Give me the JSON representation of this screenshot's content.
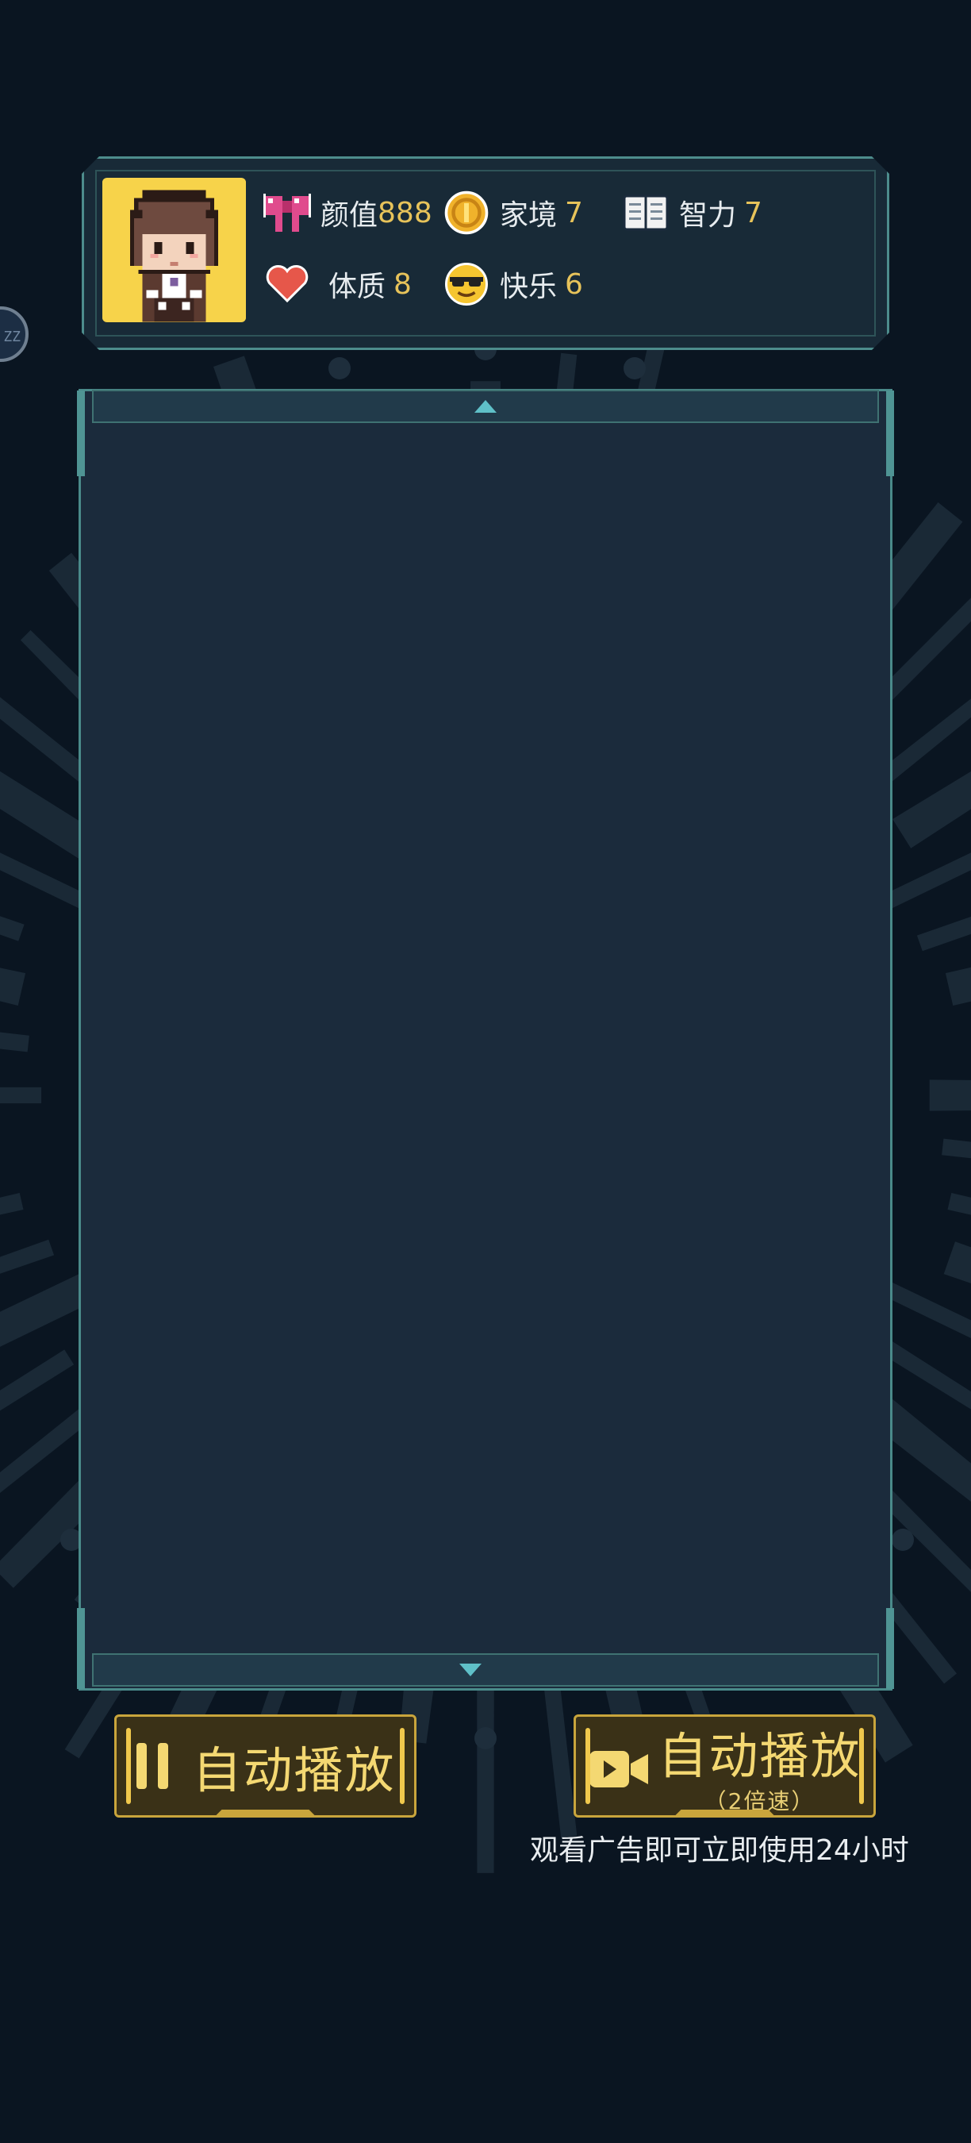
{
  "side_bubble": {
    "label": "ZZ"
  },
  "stats": [
    {
      "icon": "bow-icon",
      "label": "颜值",
      "value": "888"
    },
    {
      "icon": "coin-icon",
      "label": "家境",
      "value": "7"
    },
    {
      "icon": "book-icon",
      "label": "智力",
      "value": "7"
    },
    {
      "icon": "heart-icon",
      "label": "体质",
      "value": "8"
    },
    {
      "icon": "sunglasses-face-icon",
      "label": "快乐",
      "value": "6"
    }
  ],
  "avatar": {
    "icon": "pixel-girl-avatar"
  },
  "story": {
    "scroll_up_icon": "triangle-up-icon",
    "scroll_down_icon": "triangle-down-icon"
  },
  "buttons": {
    "autoplay": {
      "icon": "pause-icon",
      "label": "自动播放"
    },
    "autoplay_fast": {
      "icon": "video-camera-icon",
      "label": "自动播放",
      "sub": "（2倍速）"
    }
  },
  "ad_note": "观看广告即可立即使用24小时",
  "colors": {
    "background": "#0a1521",
    "panel": "#1b2b3c",
    "frame": "#4a8a8a",
    "gold": "#e7c35a",
    "avatar_bg": "#f7d34a"
  }
}
